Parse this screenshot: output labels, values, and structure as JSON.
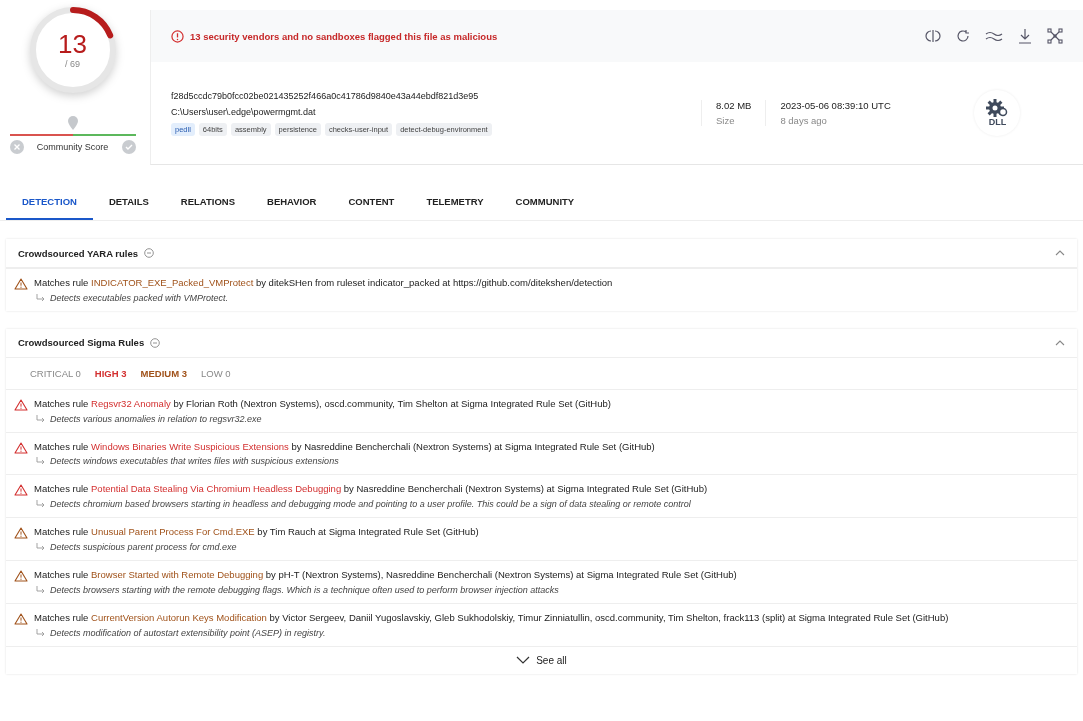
{
  "score": {
    "detections": "13",
    "total": "/ 69",
    "label": "Community Score"
  },
  "alert": {
    "text": "13 security vendors and no sandboxes flagged this file as malicious"
  },
  "file": {
    "hash": "f28d5ccdc79b0fcc02be021435252f466a0c41786d9840e43a44ebdf821d3e95",
    "path": "C:\\Users\\user\\.edge\\powermgmt.dat",
    "tags": [
      {
        "label": "pedll",
        "kind": "type"
      },
      {
        "label": "64bits",
        "kind": "tag"
      },
      {
        "label": "assembly",
        "kind": "tag"
      },
      {
        "label": "persistence",
        "kind": "tag"
      },
      {
        "label": "checks-user-input",
        "kind": "tag"
      },
      {
        "label": "detect-debug-environment",
        "kind": "tag"
      }
    ],
    "size": "8.02 MB",
    "size_label": "Size",
    "date": "2023-05-06 08:39:10 UTC",
    "date_label": "8 days ago",
    "type": "DLL"
  },
  "tabs": [
    {
      "label": "DETECTION",
      "selected": true
    },
    {
      "label": "DETAILS",
      "selected": false
    },
    {
      "label": "RELATIONS",
      "selected": false
    },
    {
      "label": "BEHAVIOR",
      "selected": false
    },
    {
      "label": "CONTENT",
      "selected": false
    },
    {
      "label": "TELEMETRY",
      "selected": false
    },
    {
      "label": "COMMUNITY",
      "selected": false
    }
  ],
  "sections": [
    {
      "title": "Crowdsourced YARA rules",
      "expanded": true,
      "rules": [
        {
          "kind": "medium",
          "prefix": "Matches rule",
          "name": "INDICATOR_EXE_Packed_VMProtect",
          "suffix": "by ditekSHen from ruleset indicator_packed at https://github.com/ditekshen/detection",
          "description": "Detects executables packed with VMProtect."
        }
      ]
    },
    {
      "title": "Crowdsourced Sigma Rules",
      "expanded": true,
      "filters": [
        {
          "label": "CRITICAL",
          "count": "0",
          "kind": "none"
        },
        {
          "label": "HIGH",
          "count": "3",
          "kind": "high"
        },
        {
          "label": "MEDIUM",
          "count": "3",
          "kind": "medium"
        },
        {
          "label": "LOW",
          "count": "0",
          "kind": "none"
        }
      ],
      "rules": [
        {
          "kind": "high",
          "prefix": "Matches rule",
          "name": "Regsvr32 Anomaly",
          "suffix": "by Florian Roth (Nextron Systems), oscd.community, Tim Shelton at Sigma Integrated Rule Set (GitHub)",
          "description": "Detects various anomalies in relation to regsvr32.exe"
        },
        {
          "kind": "high",
          "prefix": "Matches rule",
          "name": "Windows Binaries Write Suspicious Extensions",
          "suffix": "by Nasreddine Bencherchali (Nextron Systems) at Sigma Integrated Rule Set (GitHub)",
          "description": "Detects windows executables that writes files with suspicious extensions"
        },
        {
          "kind": "high",
          "prefix": "Matches rule",
          "name": "Potential Data Stealing Via Chromium Headless Debugging",
          "suffix": "by Nasreddine Bencherchali (Nextron Systems) at Sigma Integrated Rule Set (GitHub)",
          "description": "Detects chromium based browsers starting in headless and debugging mode and pointing to a user profile. This could be a sign of data stealing or remote control"
        },
        {
          "kind": "medium",
          "prefix": "Matches rule",
          "name": "Unusual Parent Process For Cmd.EXE",
          "suffix": "by Tim Rauch at Sigma Integrated Rule Set (GitHub)",
          "description": "Detects suspicious parent process for cmd.exe"
        },
        {
          "kind": "medium",
          "prefix": "Matches rule",
          "name": "Browser Started with Remote Debugging",
          "suffix": "by pH-T (Nextron Systems), Nasreddine Bencherchali (Nextron Systems) at Sigma Integrated Rule Set (GitHub)",
          "description": "Detects browsers starting with the remote debugging flags. Which is a technique often used to perform browser injection attacks"
        },
        {
          "kind": "medium",
          "prefix": "Matches rule",
          "name": "CurrentVersion Autorun Keys Modification",
          "suffix": "by Victor Sergeev, Daniil Yugoslavskiy, Gleb Sukhodolskiy, Timur Zinniatullin, oscd.community, Tim Shelton, frack113 (split) at Sigma Integrated Rule Set (GitHub)",
          "description": "Detects modification of autostart extensibility point (ASEP) in registry."
        }
      ],
      "see_all": "See all"
    }
  ]
}
